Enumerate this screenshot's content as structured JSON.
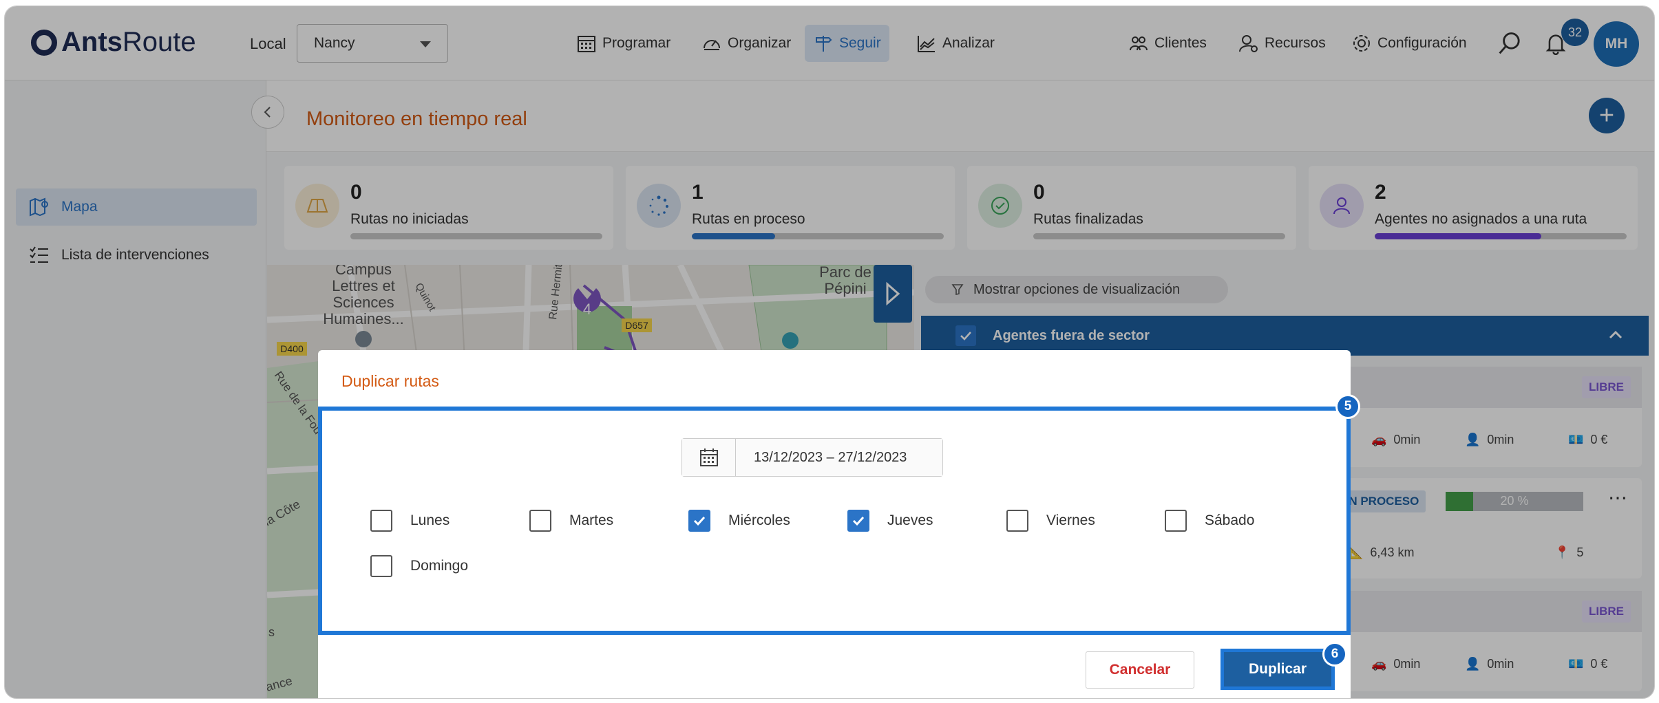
{
  "app": {
    "logo_bold": "Ants",
    "logo_light": "Route"
  },
  "header": {
    "local_label": "Local",
    "local_value": "Nancy",
    "nav": [
      {
        "label": "Programar",
        "icon": "calendar-icon"
      },
      {
        "label": "Organizar",
        "icon": "gauge-icon"
      },
      {
        "label": "Seguir",
        "icon": "signpost-icon"
      },
      {
        "label": "Analizar",
        "icon": "chart-icon"
      }
    ],
    "right_nav": [
      {
        "label": "Clientes",
        "icon": "users-icon"
      },
      {
        "label": "Recursos",
        "icon": "user-gear-icon"
      },
      {
        "label": "Configuración",
        "icon": "gear-icon"
      }
    ],
    "notifications": "32",
    "avatar": "MH"
  },
  "sidebar": {
    "items": [
      {
        "label": "Mapa",
        "icon": "map-icon"
      },
      {
        "label": "Lista de intervenciones",
        "icon": "checklist-icon"
      }
    ]
  },
  "page": {
    "title": "Monitoreo en tiempo real"
  },
  "stats": [
    {
      "value": "0",
      "label": "Rutas no iniciadas",
      "progress": 0,
      "color": "#e0a646"
    },
    {
      "value": "1",
      "label": "Rutas en proceso",
      "progress": 0.33,
      "color": "#2b74c7"
    },
    {
      "value": "0",
      "label": "Rutas finalizadas",
      "progress": 0,
      "color": "#3aa55b"
    },
    {
      "value": "2",
      "label": "Agentes no asignados a una ruta",
      "progress": 0.66,
      "color": "#6a3fd6"
    }
  ],
  "map": {
    "labels": [
      "Campus Lettres et Sciences Humaines...",
      "Parc de Pépini",
      "Rue Hermite",
      "D657",
      "D400",
      "Rue de la Fou",
      "la Côte",
      "ance",
      "Quinot",
      "s"
    ],
    "cluster_count": "4"
  },
  "panel": {
    "visibility": "Mostrar opciones de visualización",
    "group": "Agentes fuera de sector",
    "cards": [
      {
        "badge": "LIBRE",
        "metrics": [
          "0min",
          "0min",
          "0 €"
        ]
      },
      {
        "badge": "EN PROCESO",
        "progress_label": "20 %",
        "progress": 0.2,
        "metrics": [
          "6,43 km",
          "5"
        ]
      },
      {
        "badge": "LIBRE",
        "metrics": [
          "0min",
          "0min",
          "0 €"
        ]
      }
    ]
  },
  "modal": {
    "title": "Duplicar rutas",
    "date_range": "13/12/2023 – 27/12/2023",
    "days": [
      {
        "label": "Lunes",
        "checked": false
      },
      {
        "label": "Martes",
        "checked": false
      },
      {
        "label": "Miércoles",
        "checked": true
      },
      {
        "label": "Jueves",
        "checked": true
      },
      {
        "label": "Viernes",
        "checked": false
      },
      {
        "label": "Sábado",
        "checked": false
      },
      {
        "label": "Domingo",
        "checked": false
      }
    ],
    "cancel": "Cancelar",
    "confirm": "Duplicar",
    "marker_body": "5",
    "marker_confirm": "6"
  }
}
